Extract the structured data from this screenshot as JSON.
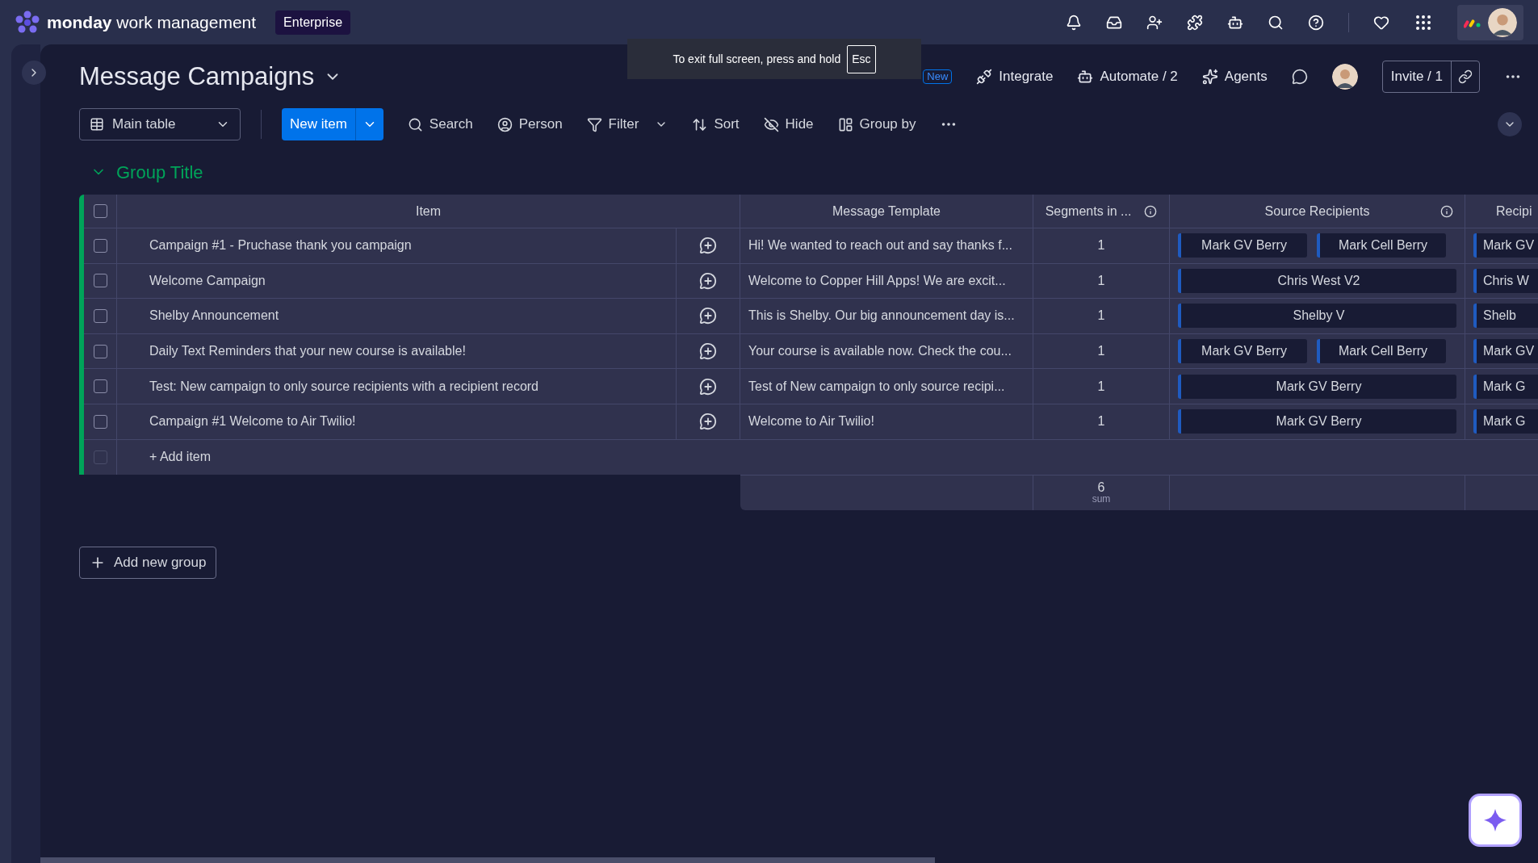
{
  "app": {
    "brand_bold": "monday",
    "brand_rest": "work management",
    "plan": "Enterprise"
  },
  "toast": {
    "text": "To exit full screen, press and hold",
    "key": "Esc"
  },
  "board": {
    "title": "Message Campaigns",
    "new_badge": "New",
    "actions": [
      "Integrate",
      "Automate / 2",
      "Agents"
    ],
    "invite": "Invite / 1"
  },
  "toolbar": {
    "view": "Main table",
    "new_item": "New item",
    "tools": [
      {
        "kind": "search",
        "label": "Search"
      },
      {
        "kind": "person",
        "label": "Person"
      },
      {
        "kind": "filter",
        "label": "Filter"
      },
      {
        "kind": "sort",
        "label": "Sort"
      },
      {
        "kind": "hide",
        "label": "Hide"
      },
      {
        "kind": "group",
        "label": "Group by"
      }
    ]
  },
  "group": {
    "title": "Group Title",
    "expanded": true,
    "color": "#00a359"
  },
  "table": {
    "columns": [
      "Item",
      "Message Template",
      "Segments in ...",
      "Source Recipients",
      "Recipi"
    ],
    "rows": [
      {
        "item": "Campaign #1 - Pruchase thank you campaign",
        "checked": false,
        "template": "Hi! We wanted to reach out and say thanks f...",
        "segments": "1",
        "source": [
          "Mark GV Berry",
          "Mark Cell Berry"
        ],
        "column_5": "Mark GV"
      },
      {
        "item": "Welcome Campaign",
        "checked": false,
        "template": "Welcome to Copper Hill Apps! We are excit...",
        "segments": "1",
        "source": [
          "Chris West V2"
        ],
        "column_5": "Chris W"
      },
      {
        "item": "Shelby Announcement",
        "checked": false,
        "template": "This is Shelby. Our big announcement day is...",
        "segments": "1",
        "source": [
          "Shelby V"
        ],
        "column_5": "Shelb"
      },
      {
        "item": "Daily Text Reminders that your new course is available!",
        "checked": false,
        "template": "Your course is available now. Check the cou...",
        "segments": "1",
        "source": [
          "Mark GV Berry",
          "Mark Cell Berry"
        ],
        "column_5": "Mark GV"
      },
      {
        "item": "Test: New campaign to only source recipients with a recipient record",
        "checked": false,
        "template": "Test of New campaign to only source recipi...",
        "segments": "1",
        "source": [
          "Mark GV Berry"
        ],
        "column_5": "Mark G"
      },
      {
        "item": "Campaign #1 Welcome to Air Twilio!",
        "checked": false,
        "template": "Welcome to Air Twilio!",
        "segments": "1",
        "source": [
          "Mark GV Berry"
        ],
        "column_5": "Mark G"
      }
    ],
    "all_checked": false,
    "add_row_checked": false,
    "add_item": "+ Add item",
    "sum_value": "6",
    "sum_label": "sum"
  },
  "add_group": "Add new group"
}
